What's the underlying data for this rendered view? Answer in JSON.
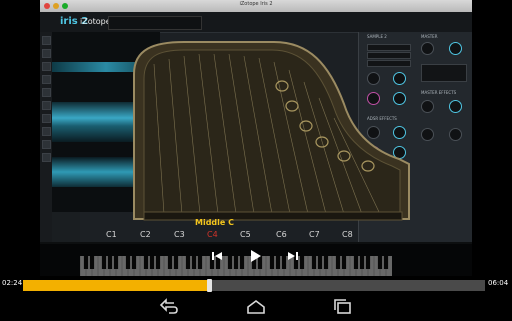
{
  "window": {
    "title": "iZotope Iris 2"
  },
  "app": {
    "logo_iris": "iris 2",
    "logo_izotope": "iZotope",
    "right_panel": {
      "sample_header": "SAMPLE 2",
      "master_header": "MASTER",
      "tabs": [
        "MAIN",
        "SAMPLE"
      ],
      "section_labels": [
        "ADSR EFFECTS",
        "MASTER EFFECTS"
      ]
    }
  },
  "overlay": {
    "middle_c_label": "Middle C",
    "octave_notes": [
      "C1",
      "C2",
      "C3",
      "C4",
      "C5",
      "C6",
      "C7",
      "C8"
    ],
    "active_note": "C4"
  },
  "player": {
    "current_time": "02:24",
    "duration": "06:04",
    "progress": 0.403,
    "controls": [
      "previous",
      "play",
      "next"
    ]
  },
  "colors": {
    "accent_cyan": "#4fc6e3",
    "progress_fill": "#f3b000",
    "middle_c": "#f4c61d",
    "active_note": "#d2332a"
  },
  "icons": [
    "skip-previous-icon",
    "play-icon",
    "skip-next-icon",
    "back-icon",
    "home-icon",
    "recent-apps-icon"
  ]
}
